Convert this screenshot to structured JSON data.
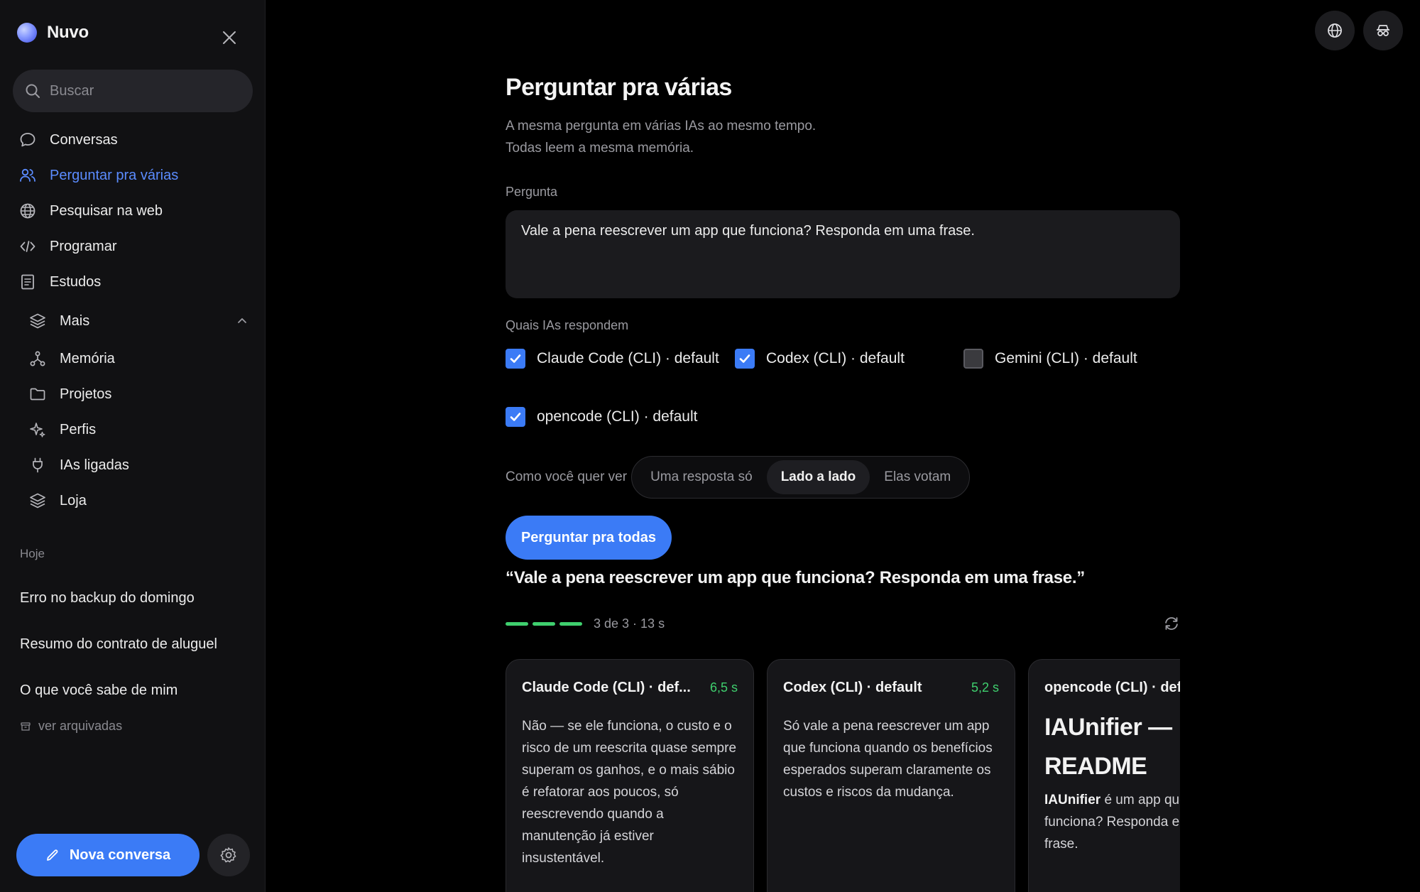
{
  "sidebar": {
    "brand": "Nuvo",
    "search_placeholder": "Buscar",
    "nav": [
      {
        "label": "Conversas",
        "icon": "chat-bubble-icon"
      },
      {
        "label": "Perguntar pra várias",
        "icon": "users-icon",
        "active": true
      },
      {
        "label": "Pesquisar na web",
        "icon": "globe-icon"
      },
      {
        "label": "Programar",
        "icon": "code-icon"
      },
      {
        "label": "Estudos",
        "icon": "notebook-icon"
      }
    ],
    "more": {
      "label": "Mais",
      "items": [
        {
          "label": "Memória",
          "icon": "network-icon"
        },
        {
          "label": "Projetos",
          "icon": "folder-icon"
        },
        {
          "label": "Perfis",
          "icon": "sparkle-icon"
        },
        {
          "label": "IAs ligadas",
          "icon": "plug-icon"
        },
        {
          "label": "Loja",
          "icon": "layers-icon"
        }
      ]
    },
    "section_today": "Hoje",
    "conversations": [
      "Erro no backup do domingo",
      "Resumo do contrato de aluguel",
      "O que você sabe de mim"
    ],
    "archived_label": "ver arquivadas",
    "new_chat_label": "Nova conversa"
  },
  "main": {
    "title": "Perguntar pra várias",
    "subtitle_line1": "A mesma pergunta em várias IAs ao mesmo tempo.",
    "subtitle_line2": "Todas leem a mesma memória.",
    "question_label": "Pergunta",
    "question_value": "Vale a pena reescrever um app que funciona? Responda em uma frase.",
    "models_label": "Quais IAs respondem",
    "models": [
      {
        "label": "Claude Code (CLI) · default",
        "checked": true
      },
      {
        "label": "Codex (CLI) · default",
        "checked": true
      },
      {
        "label": "Gemini (CLI) · default",
        "checked": false
      },
      {
        "label": "opencode (CLI) · default",
        "checked": true
      }
    ],
    "view_label": "Como você quer ver",
    "view_options": [
      "Uma resposta só",
      "Lado a lado",
      "Elas votam"
    ],
    "view_selected": "Lado a lado",
    "ask_button": "Perguntar pra todas",
    "quoted_question": "“Vale a pena reescrever um app que funciona? Responda em uma frase.”",
    "progress": {
      "done": 3,
      "total": 3,
      "text": "3 de 3 · 13 s"
    },
    "answers": [
      {
        "name": "Claude Code (CLI) · def...",
        "time": "6,5 s",
        "text": "Não — se ele funciona, o custo e o risco de um reescrita quase sempre superam os ganhos, e o mais sábio é refatorar aos poucos, só reescrevendo quando a manutenção já estiver insustentável."
      },
      {
        "name": "Codex (CLI) · default",
        "time": "5,2 s",
        "text": "Só vale a pena reescrever um app que funciona quando os benefícios esperados superam claramente os custos e riscos da mudança."
      },
      {
        "name": "opencode (CLI) · default",
        "heading": "IAUnifier — README",
        "bold": "IAUnifier",
        "line1_rest": " é um app que",
        "line2": "funciona? Responda em uma",
        "line3": "frase."
      }
    ]
  },
  "colors": {
    "accent": "#3b7bf6",
    "success": "#3fcf6e",
    "background": "#000000",
    "sidebar": "#111113"
  }
}
